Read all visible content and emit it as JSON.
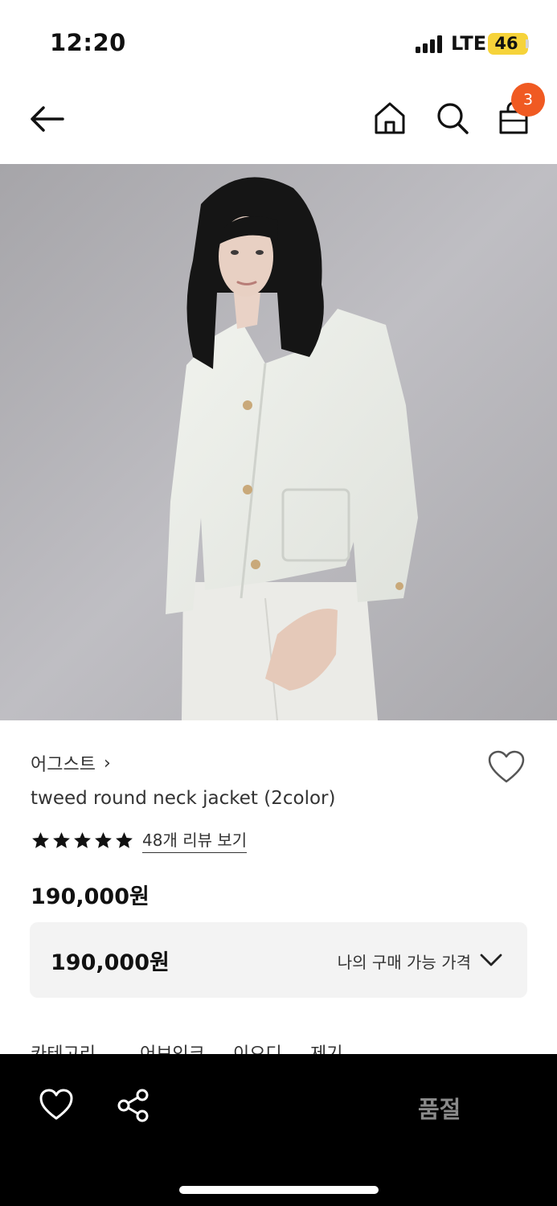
{
  "status_bar": {
    "time": "12:20",
    "network": "LTE",
    "battery": "46",
    "battery_color": "#f6d33a"
  },
  "nav": {
    "back_icon": "arrow-left-icon",
    "home_icon": "home-icon",
    "search_icon": "search-icon",
    "cart_icon": "shopping-bag-icon",
    "cart_count": "3",
    "badge_color": "#f05a22"
  },
  "product": {
    "brand": "어그스트",
    "brand_chevron": "›",
    "name": "tweed round neck jacket (2color)",
    "rating_stars": 5,
    "review_link": "48개 리뷰 보기",
    "price": "190,000원",
    "price_box": {
      "value": "190,000원",
      "label": "나의 구매 가능 가격"
    }
  },
  "tabs": [
    "카테고리",
    "어브인크",
    "이으디",
    "제기"
  ],
  "bottom_bar": {
    "wishlist_icon": "heart-icon",
    "share_icon": "share-icon",
    "status_label": "품절"
  }
}
